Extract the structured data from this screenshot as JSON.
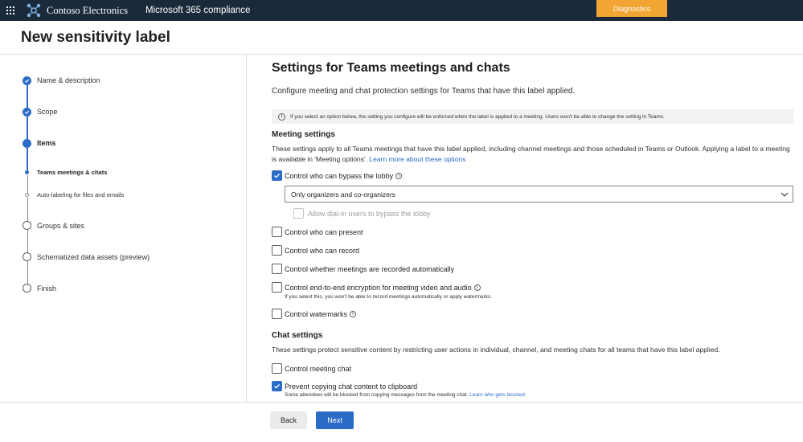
{
  "topbar": {
    "org_name": "Contoso Electronics",
    "app_name": "Microsoft 365 compliance",
    "diagnostics_label": "Diagnostics"
  },
  "page": {
    "title": "New sensitivity label"
  },
  "wizard": {
    "steps": [
      {
        "label": "Name & description",
        "state": "completed"
      },
      {
        "label": "Scope",
        "state": "completed"
      },
      {
        "label": "Items",
        "state": "current"
      },
      {
        "label": "Teams meetings & chats",
        "state": "current-sub"
      },
      {
        "label": "Auto-labeling for files and emails",
        "state": "pending-sub"
      },
      {
        "label": "Groups & sites",
        "state": "pending"
      },
      {
        "label": "Schematized data assets (preview)",
        "state": "pending"
      },
      {
        "label": "Finish",
        "state": "pending"
      }
    ]
  },
  "main": {
    "title": "Settings for Teams meetings and chats",
    "description": "Configure meeting and chat protection settings for Teams that have this label applied.",
    "info_text": "If you select an option below, the setting you configure will be enforced when the label is applied to a meeting. Users won't be able to change the setting in Teams.",
    "meeting_settings": {
      "title": "Meeting settings",
      "description": "These settings apply to all Teams meetings that have this label applied, including channel meetings and those scheduled in Teams or Outlook. Applying a label to a meeting is available in 'Meeting options'. ",
      "learn_more": "Learn more about these options",
      "bypass_lobby": {
        "label": "Control who can bypass the lobby",
        "checked": true
      },
      "lobby_dropdown": {
        "value": "Only organizers and co-organizers"
      },
      "dial_in": {
        "label": "Allow dial-in users to bypass the lobby",
        "checked": false,
        "disabled": true
      },
      "who_can_present": {
        "label": "Control who can present",
        "checked": false
      },
      "who_can_record": {
        "label": "Control who can record",
        "checked": false
      },
      "recorded_auto": {
        "label": "Control whether meetings are recorded automatically",
        "checked": false
      },
      "e2e_encryption": {
        "label": "Control end-to-end encryption for meeting video and audio",
        "checked": false,
        "helper": "If you select this, you won't be able to record meetings automatically or apply watermarks."
      },
      "watermarks": {
        "label": "Control watermarks",
        "checked": false
      }
    },
    "chat_settings": {
      "title": "Chat settings",
      "description": "These settings protect sensitive content by restricting user actions in individual, channel, and meeting chats for all teams that have this label applied.",
      "meeting_chat": {
        "label": "Control meeting chat",
        "checked": false
      },
      "prevent_copy": {
        "label": "Prevent copying chat content to clipboard",
        "checked": true,
        "helper": "Some attendees will be blocked from copying messages from the meeting chat. ",
        "helper_link": "Learn who gets blocked"
      }
    }
  },
  "footer": {
    "back_label": "Back",
    "next_label": "Next"
  },
  "colors": {
    "topbar_bg": "#1b2a3a",
    "diagnostics_bg": "#f2a532",
    "accent": "#2b6cc8"
  }
}
